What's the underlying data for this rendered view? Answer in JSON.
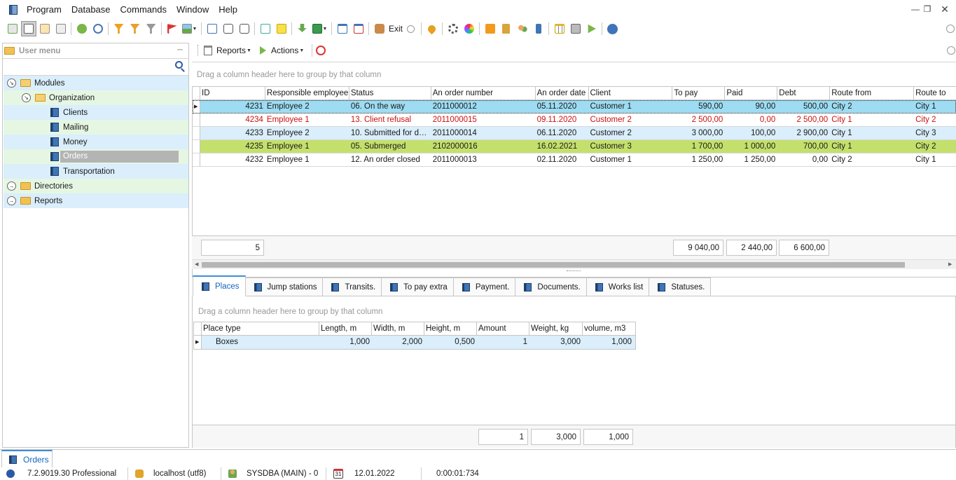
{
  "menubar": {
    "items": [
      "Program",
      "Database",
      "Commands",
      "Window",
      "Help"
    ]
  },
  "toolbar": {
    "exit_label": "Exit"
  },
  "left_panel": {
    "title": "User menu",
    "tree": [
      {
        "label": "Modules"
      },
      {
        "label": "Organization"
      },
      {
        "label": "Clients"
      },
      {
        "label": "Mailing"
      },
      {
        "label": "Money"
      },
      {
        "label": "Orders"
      },
      {
        "label": "Transportation"
      },
      {
        "label": "Directories"
      },
      {
        "label": "Reports"
      }
    ]
  },
  "right_toolbar": {
    "reports_label": "Reports",
    "actions_label": "Actions"
  },
  "orders_grid": {
    "group_hint": "Drag a column header here to group by that column",
    "columns": [
      "ID",
      "Responsible employee",
      "Status",
      "An order number",
      "An order date",
      "Client",
      "To pay",
      "Paid",
      "Debt",
      "Route from",
      "Route to"
    ],
    "rows": [
      [
        "4231",
        "Employee 2",
        "06. On the way",
        "2011000012",
        "05.11.2020",
        "Customer 1",
        "590,00",
        "90,00",
        "500,00",
        "City 2",
        "City 1"
      ],
      [
        "4234",
        "Employee 1",
        "13. Client refusal",
        "2011000015",
        "09.11.2020",
        "Customer 2",
        "2 500,00",
        "0,00",
        "2 500,00",
        "City 1",
        "City 2"
      ],
      [
        "4233",
        "Employee 2",
        "10. Submitted for de…",
        "2011000014",
        "06.11.2020",
        "Customer 2",
        "3 000,00",
        "100,00",
        "2 900,00",
        "City 1",
        "City 3"
      ],
      [
        "4235",
        "Employee 1",
        "05. Submerged",
        "2102000016",
        "16.02.2021",
        "Customer 3",
        "1 700,00",
        "1 000,00",
        "700,00",
        "City 1",
        "City 2"
      ],
      [
        "4232",
        "Employee 1",
        "12. An order closed",
        "2011000013",
        "02.11.2020",
        "Customer 1",
        "1 250,00",
        "1 250,00",
        "0,00",
        "City 2",
        "City 1"
      ]
    ],
    "footer": {
      "count": "5",
      "to_pay": "9 040,00",
      "paid": "2 440,00",
      "debt": "6 600,00"
    }
  },
  "detail_tabs": [
    "Places",
    "Jump stations",
    "Transits.",
    "To pay extra",
    "Payment.",
    "Documents.",
    "Works list",
    "Statuses."
  ],
  "places_grid": {
    "group_hint": "Drag a column header here to group by that column",
    "columns": [
      "Place type",
      "Length, m",
      "Width, m",
      "Height, m",
      "Amount",
      "Weight, kg",
      "volume, m3"
    ],
    "rows": [
      [
        "Boxes",
        "1,000",
        "2,000",
        "0,500",
        "1",
        "3,000",
        "1,000"
      ]
    ],
    "footer": {
      "amount": "1",
      "weight": "3,000",
      "volume": "1,000"
    }
  },
  "bottom_tab": {
    "label": "Orders"
  },
  "statusbar": {
    "version": "7.2.9019.30 Professional",
    "database": "localhost (utf8)",
    "user": "SYSDBA (MAIN) - 0",
    "date": "12.01.2022",
    "timer": "0:00:01:734",
    "calendar_day": "31"
  },
  "colors": {
    "selected_row": "#9ddcf2",
    "green_row": "#c4e06c",
    "light_blue": "#daeefb",
    "accent": "#3b8fd9",
    "red_text": "#cc1111"
  }
}
